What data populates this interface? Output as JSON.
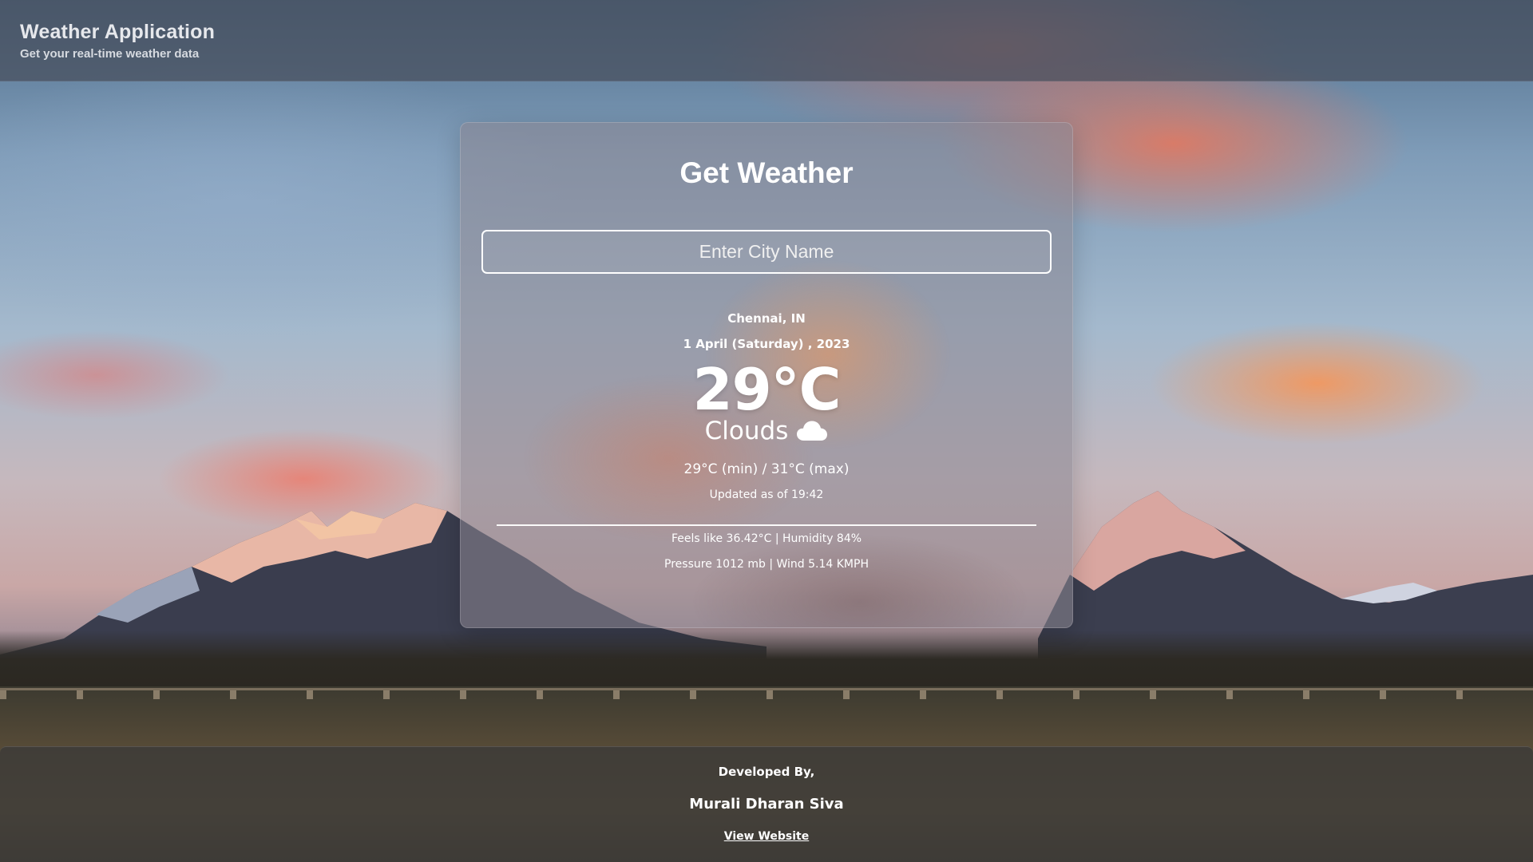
{
  "header": {
    "title": "Weather Application",
    "subtitle": "Get your real-time weather data"
  },
  "card": {
    "title": "Get Weather",
    "search": {
      "placeholder": "Enter City Name",
      "value": ""
    },
    "weather": {
      "location": "Chennai, IN",
      "date": "1 April (Saturday) , 2023",
      "temperature": "29°C",
      "condition": "Clouds",
      "condition_icon": "cloud-icon",
      "min_max": "29°C (min) / 31°C (max)",
      "updated": "Updated as of 19:42",
      "feels_humidity": "Feels like 36.42°C | Humidity 84%",
      "pressure_wind": "Pressure 1012 mb | Wind 5.14 KMPH"
    }
  },
  "footer": {
    "developed_by_label": "Developed By,",
    "developer_name": "Murali Dharan Siva",
    "website_link": "View Website"
  },
  "colors": {
    "text": "#ffffff",
    "header_bg": "#464e5c",
    "footer_bg": "#3c3a38"
  }
}
